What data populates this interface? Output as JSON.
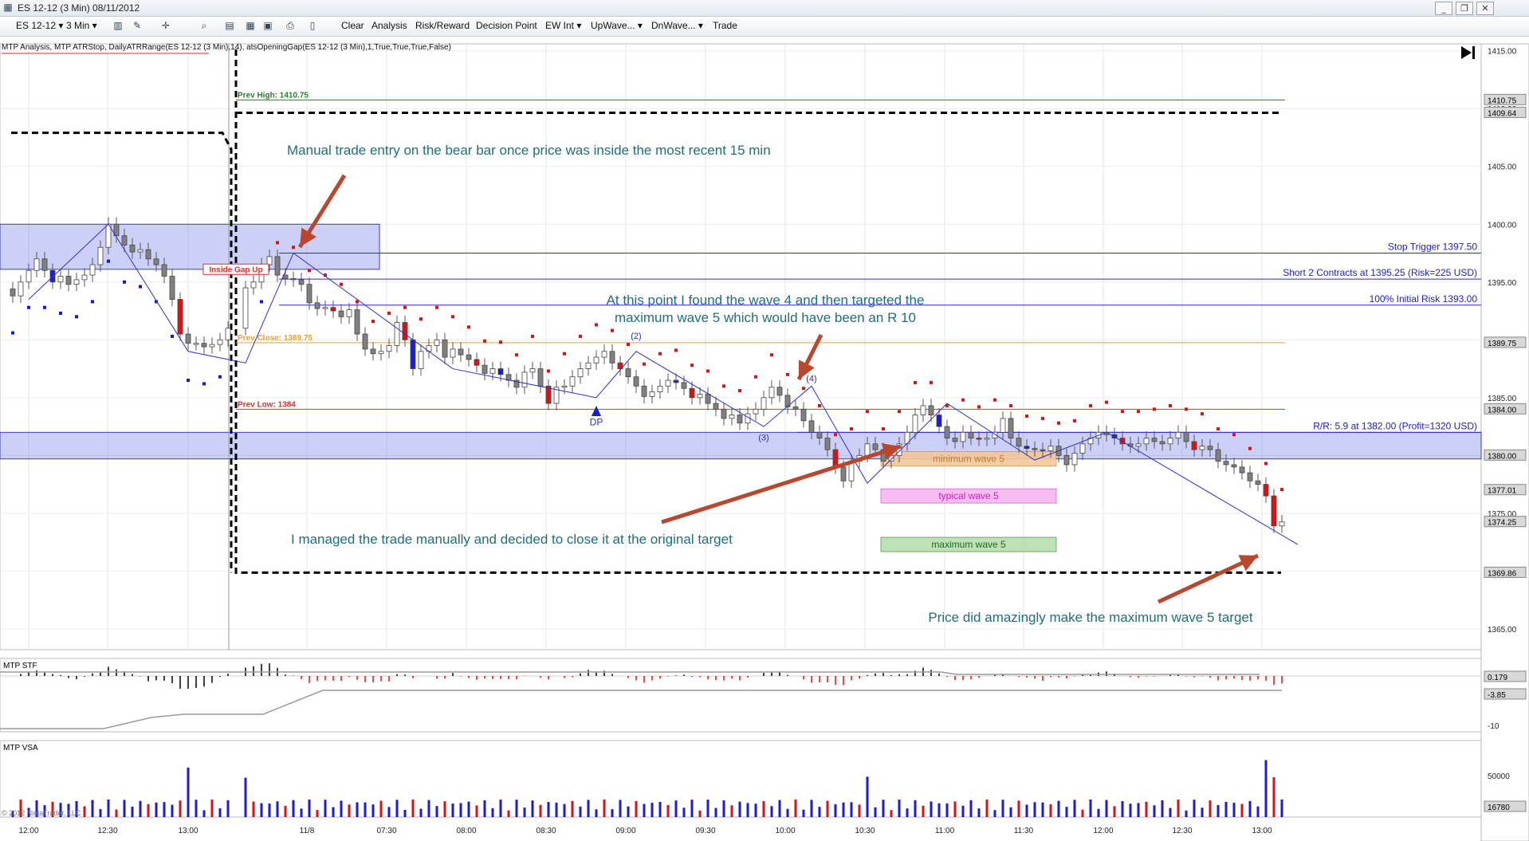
{
  "window": {
    "title": "ES 12-12 (3 Min)  08/11/2012",
    "controls": [
      "minimize-icon",
      "restore-icon",
      "close-icon"
    ]
  },
  "toolbar": {
    "instrument": "ES 12-12",
    "interval": "3 Min",
    "menu": [
      "Clear",
      "Analysis",
      "Risk/Reward",
      "Decision Point",
      "EW Int",
      "UpWave...",
      "DnWave...",
      "Trade"
    ],
    "icons": [
      "bar-type-icon",
      "draw-pencil-icon",
      "crosshair-icon",
      "zoom-icon",
      "data-box-icon",
      "properties-icon",
      "template-icon",
      "print-icon",
      "scroll-end-icon"
    ]
  },
  "chart_data": {
    "type": "candlestick",
    "indicator_caption": "MTP Analysis, MTP ATRStop, DailyATRRange(ES 12-12 (3 Min),14), atsOpeningGap(ES 12-12 (3 Min),1,True,True,True,False)",
    "x_ticks": [
      "12:00",
      "12:30",
      "13:00",
      "11/8",
      "07:30",
      "08:00",
      "08:30",
      "09:00",
      "09:30",
      "10:00",
      "10:30",
      "11:00",
      "11:30",
      "12:00",
      "12:30",
      "13:00"
    ],
    "y_ticks": [
      1365,
      1370,
      1375,
      1380,
      1385,
      1390,
      1395,
      1400,
      1405,
      1410,
      1415
    ],
    "ylim": [
      1363.2,
      1415.6
    ],
    "price_markers": [
      "1410.75",
      "1409.64",
      "1389.75",
      "1384.00",
      "1380.00",
      "1377.01",
      "1374.25",
      "1369.86"
    ],
    "closes": [
      1393.8,
      1395,
      1396,
      1397,
      1396,
      1395,
      1395.5,
      1394.8,
      1395.2,
      1395.6,
      1396.5,
      1398,
      1400,
      1399,
      1398.2,
      1397.6,
      1397.8,
      1397,
      1396.5,
      1395.5,
      1393.5,
      1390.5,
      1389.7,
      1389.7,
      1389.4,
      1389.6,
      1390,
      1391,
      1394.5,
      1395,
      1396.5,
      1397.2,
      1395.6,
      1395.3,
      1395.2,
      1394.8,
      1393.2,
      1392.7,
      1392.8,
      1392.5,
      1392,
      1392.6,
      1390.5,
      1389.2,
      1388.8,
      1389,
      1389.5,
      1391.5,
      1390,
      1387.5,
      1389,
      1389.5,
      1390,
      1388.5,
      1389.2,
      1388.7,
      1388.3,
      1387.8,
      1387.1,
      1387.5,
      1387,
      1386.5,
      1385.9,
      1387.2,
      1387.5,
      1386,
      1384.5,
      1385.9,
      1386,
      1386.8,
      1387.5,
      1388,
      1388.5,
      1389,
      1388,
      1387.5,
      1386.8,
      1386,
      1385.1,
      1385.5,
      1386,
      1386.5,
      1386.3,
      1385.8,
      1385,
      1385.3,
      1384.5,
      1384,
      1383.2,
      1383.5,
      1382.8,
      1383.6,
      1384,
      1385,
      1385.9,
      1385.2,
      1384.2,
      1384,
      1383,
      1382,
      1381.5,
      1380.5,
      1379,
      1377.8,
      1379.5,
      1380,
      1381,
      1380.5,
      1379.5,
      1380,
      1381,
      1382,
      1383.5,
      1384.3,
      1383.5,
      1382.5,
      1381.5,
      1381.2,
      1382,
      1381.5,
      1381.4,
      1381.5,
      1382,
      1383.2,
      1381.5,
      1380.8,
      1380.6,
      1380.5,
      1380.4,
      1380.8,
      1380,
      1379.2,
      1380.2,
      1381,
      1381.5,
      1382,
      1381.8,
      1381.5,
      1381,
      1380.8,
      1381,
      1381.5,
      1381.2,
      1381,
      1381.5,
      1382,
      1381.2,
      1380.5,
      1380.8,
      1380.5,
      1379.5,
      1379.2,
      1379,
      1378.5,
      1377.8,
      1377.5,
      1376.5,
      1373.9,
      1374.25
    ],
    "open_gap_low_index": 20,
    "session_break_index": 28,
    "levels": [
      {
        "label": "Prev High: 1410.75",
        "value": 1410.75,
        "color": "#2f7d2f"
      },
      {
        "label": "Prev Close: 1389.75",
        "value": 1389.75,
        "color": "#f0a030"
      },
      {
        "label": "Prev Low: 1384",
        "value": 1384,
        "color": "#e03030"
      }
    ],
    "trade_lines": [
      {
        "label": "Stop Trigger 1397.50",
        "value": 1397.5
      },
      {
        "label": "Short 2 Contracts at 1395.25 (Risk=225 USD)",
        "value": 1395.25
      },
      {
        "label": "100% Initial Risk 1393.00",
        "value": 1393
      },
      {
        "label": "R/R: 5.9 at 1382.00 (Profit=1320 USD)",
        "value": 1382
      }
    ],
    "zones": [
      {
        "low": 1396.1,
        "high": 1400
      },
      {
        "low": 1379.7,
        "high": 1382
      }
    ],
    "targets": [
      {
        "label": "minimum wave 5",
        "value": 1379.7,
        "color": "#f3c89a",
        "text_color": "#c87830"
      },
      {
        "label": "typical wave 5",
        "value": 1376.5,
        "color": "#f7b6ef",
        "text_color": "#d21ecb"
      },
      {
        "label": "maximum wave 5",
        "value": 1372.3,
        "color": "#b8dfae",
        "text_color": "#226622"
      }
    ],
    "wave_labels": [
      "(2)",
      "(3)",
      "(4)"
    ],
    "dp_label": "DP",
    "inside_gap_label": "Inside Gap Up",
    "annotations": [
      "Manual trade entry on the bear bar once price was inside the most recent 15 min",
      "At this point I found the wave 4 and then targeted the",
      "maximum wave 5 which would have been an R 10",
      "I managed the trade manually and decided to close it at the original target",
      "Price did amazingly make the maximum wave 5 target"
    ],
    "stf_panel": {
      "title": "MTP STF",
      "markers": [
        "0.179",
        "-3.85"
      ],
      "ticks": [
        "-10"
      ]
    },
    "vsa_panel": {
      "title": "MTP VSA",
      "markers": [
        "16780"
      ],
      "ticks": [
        "50000"
      ]
    },
    "copyright": "© 2012 NinjaTrader, LLC"
  }
}
